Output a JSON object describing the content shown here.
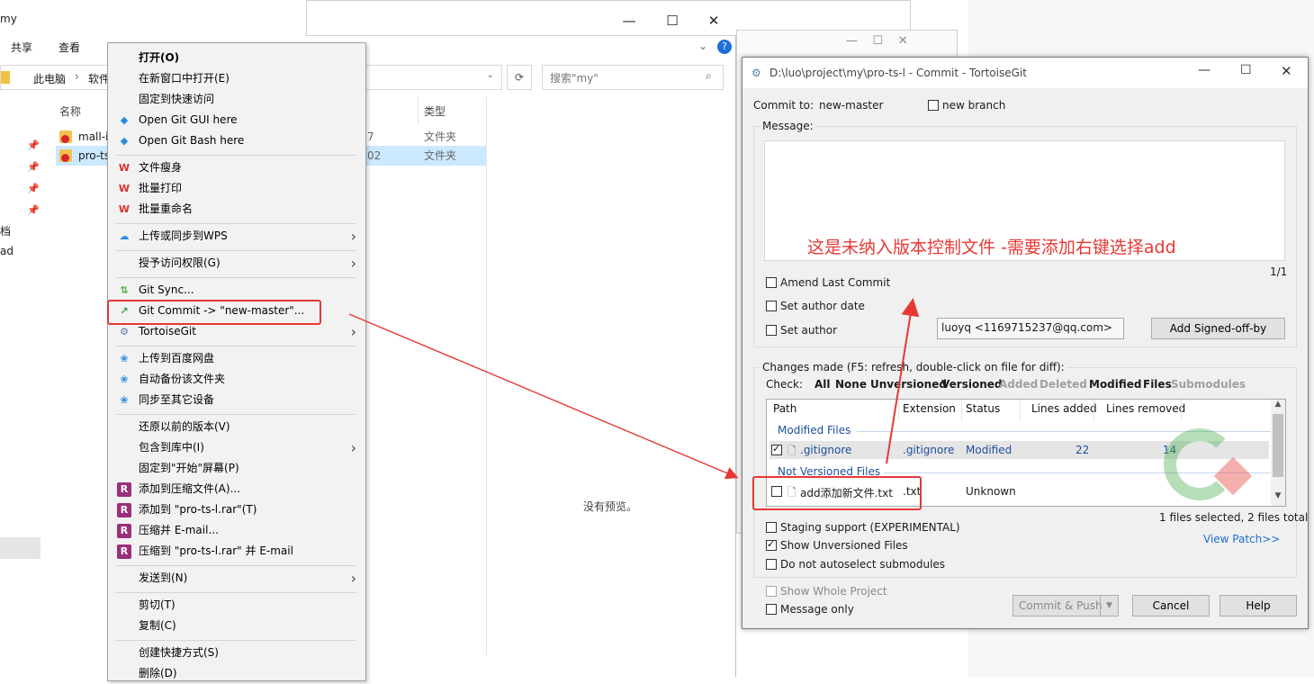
{
  "explorer": {
    "title": "my",
    "ribbon_tabs": [
      "共享",
      "查看"
    ],
    "breadcrumb": [
      "此电脑",
      "软件"
    ],
    "search_placeholder": "搜索\"my\"",
    "columns": {
      "name": "名称",
      "type": "类型"
    },
    "files": [
      {
        "name": "mall-i",
        "date_frag": "7",
        "type": "文件夹"
      },
      {
        "name": "pro-ts",
        "date_frag": "02",
        "type": "文件夹"
      }
    ],
    "sidebar_frags": [
      "档",
      "ad"
    ],
    "no_preview": "没有预览。"
  },
  "context_menu": {
    "items": [
      {
        "label": "打开(O)",
        "bold": true
      },
      {
        "label": "在新窗口中打开(E)"
      },
      {
        "label": "固定到快速访问"
      },
      {
        "label": "Open Git GUI here",
        "icon": "git-gui-icon"
      },
      {
        "label": "Open Git Bash here",
        "icon": "git-bash-icon"
      },
      {
        "label": "文件瘦身",
        "icon": "wps-icon"
      },
      {
        "label": "批量打印",
        "icon": "wps-icon"
      },
      {
        "label": "批量重命名",
        "icon": "wps-icon"
      },
      {
        "label": "上传或同步到WPS",
        "icon": "cloud-icon"
      },
      {
        "label": "授予访问权限(G)"
      },
      {
        "label": "Git Sync...",
        "icon": "git-sync-icon"
      },
      {
        "label": "Git Commit -> \"new-master\"...",
        "icon": "git-commit-icon"
      },
      {
        "label": "TortoiseGit",
        "icon": "tortoisegit-icon"
      },
      {
        "label": "上传到百度网盘",
        "icon": "baidu-icon"
      },
      {
        "label": "自动备份该文件夹",
        "icon": "baidu-icon"
      },
      {
        "label": "同步至其它设备",
        "icon": "baidu-icon"
      },
      {
        "label": "还原以前的版本(V)"
      },
      {
        "label": "包含到库中(I)"
      },
      {
        "label": "固定到\"开始\"屏幕(P)"
      },
      {
        "label": "添加到压缩文件(A)...",
        "icon": "rar-icon"
      },
      {
        "label": "添加到 \"pro-ts-l.rar\"(T)",
        "icon": "rar-icon"
      },
      {
        "label": "压缩并 E-mail...",
        "icon": "rar-icon"
      },
      {
        "label": "压缩到 \"pro-ts-l.rar\" 并 E-mail",
        "icon": "rar-icon"
      },
      {
        "label": "发送到(N)"
      },
      {
        "label": "剪切(T)"
      },
      {
        "label": "复制(C)"
      },
      {
        "label": "创建快捷方式(S)"
      },
      {
        "label": "删除(D)"
      }
    ]
  },
  "commit_dialog": {
    "title": "D:\\luo\\project\\my\\pro-ts-l - Commit - TortoiseGit",
    "commit_to_label": "Commit to:",
    "branch": "new-master",
    "new_branch_label": "new branch",
    "message_label": "Message:",
    "annotation": "这是未纳入版本控制文件 -需要添加右键选择add",
    "page_counter": "1/1",
    "amend_label": "Amend Last Commit",
    "set_author_date_label": "Set author date",
    "set_author_label": "Set author",
    "author_value": "luoyq <1169715237@qq.com>",
    "signed_off_button": "Add Signed-off-by",
    "changes_label": "Changes made (F5: refresh, double-click on file for diff):",
    "check_label": "Check:",
    "check_filters": [
      {
        "label": "All",
        "enabled": true
      },
      {
        "label": "None",
        "enabled": true
      },
      {
        "label": "Unversioned",
        "enabled": true
      },
      {
        "label": "Versioned",
        "enabled": true
      },
      {
        "label": "Added",
        "enabled": false
      },
      {
        "label": "Deleted",
        "enabled": false
      },
      {
        "label": "Modified",
        "enabled": true
      },
      {
        "label": "Files",
        "enabled": true
      },
      {
        "label": "Submodules",
        "enabled": false
      }
    ],
    "columns": [
      "Path",
      "Extension",
      "Status",
      "Lines added",
      "Lines removed"
    ],
    "groups": {
      "modified": "Modified Files",
      "unversioned": "Not Versioned Files"
    },
    "rows": [
      {
        "path": ".gitignore",
        "ext": ".gitignore",
        "status": "Modified",
        "added": "22",
        "removed": "14",
        "checked": true
      },
      {
        "path": "add添加新文件.txt",
        "ext": ".txt",
        "status": "Unknown",
        "added": "",
        "removed": "",
        "checked": false
      }
    ],
    "selection_summary": "1 files selected, 2 files total",
    "staging_label": "Staging support (EXPERIMENTAL)",
    "show_unversioned_label": "Show Unversioned Files",
    "no_autoselect_label": "Do not autoselect submodules",
    "view_patch": "View Patch>>",
    "show_whole_project_label": "Show Whole Project",
    "message_only_label": "Message only",
    "commit_push_button": "Commit & Push",
    "cancel_button": "Cancel",
    "help_button": "Help"
  },
  "colors": {
    "highlight": "#e53935",
    "accent_blue": "#1c4f9c",
    "menu_bg": "#f2f2f2"
  }
}
